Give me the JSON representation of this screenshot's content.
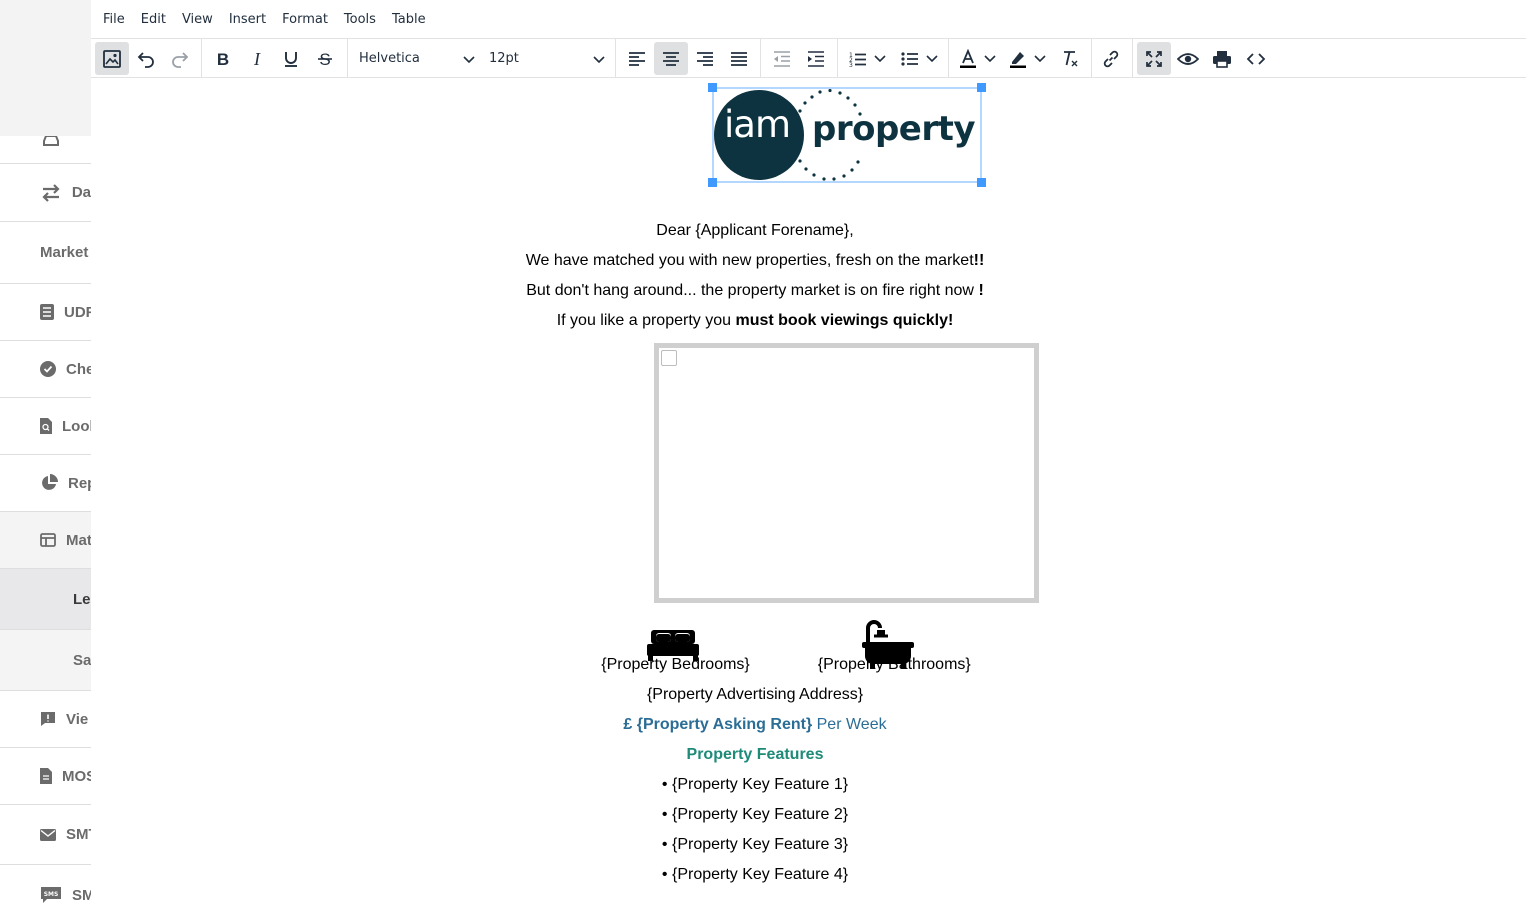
{
  "sidebar": {
    "items": [
      {
        "label": "Da",
        "icon": "swap-arrows-icon"
      },
      {
        "label": "Market",
        "icon": ""
      },
      {
        "label": "UDF",
        "icon": "list-icon"
      },
      {
        "label": "Che",
        "icon": "check-circle-icon"
      },
      {
        "label": "Lool",
        "icon": "file-search-icon"
      },
      {
        "label": "Rep",
        "icon": "pie-chart-icon"
      },
      {
        "label": "Mat",
        "icon": "layout-icon"
      },
      {
        "label": "Le",
        "icon": ""
      },
      {
        "label": "Sa",
        "icon": ""
      },
      {
        "label": "Vie",
        "icon": "comment-alert-icon"
      },
      {
        "label": "MOS",
        "icon": "document-icon"
      },
      {
        "label": "SMT",
        "icon": "envelope-icon"
      },
      {
        "label": "SM",
        "icon": "sms-icon"
      }
    ]
  },
  "menubar": {
    "items": [
      "File",
      "Edit",
      "View",
      "Insert",
      "Format",
      "Tools",
      "Table"
    ]
  },
  "toolbar": {
    "font_family": "Helvetica",
    "font_size": "12pt"
  },
  "document": {
    "logo_text_left": "iam",
    "logo_text_right": "property",
    "greeting": "Dear {Applicant Forename},",
    "line1": "We have matched you with new properties, fresh on the market",
    "line1_bold": "!!",
    "line2": "But don't hang around... the property market is on fire right now ",
    "line2_bold": "!",
    "line3_prefix": "If you like a property you ",
    "line3_bold": "must book viewings quickly!",
    "bedrooms": "{Property Bedrooms}",
    "bathrooms": "{Property Bathrooms}",
    "address": "{Property Advertising Address}",
    "rent_bold": "£ {Property Asking Rent}",
    "rent_suffix": " Per Week",
    "features_heading": "Property Features",
    "features": [
      "• {Property Key Feature 1}",
      "• {Property Key Feature 2}",
      "• {Property Key Feature 3}",
      "• {Property Key Feature 4}"
    ],
    "colors": {
      "accent_blue": "#2b6d96",
      "accent_teal": "#1e8a78",
      "logo": "#0d3341",
      "selection": "#4099ff"
    }
  }
}
